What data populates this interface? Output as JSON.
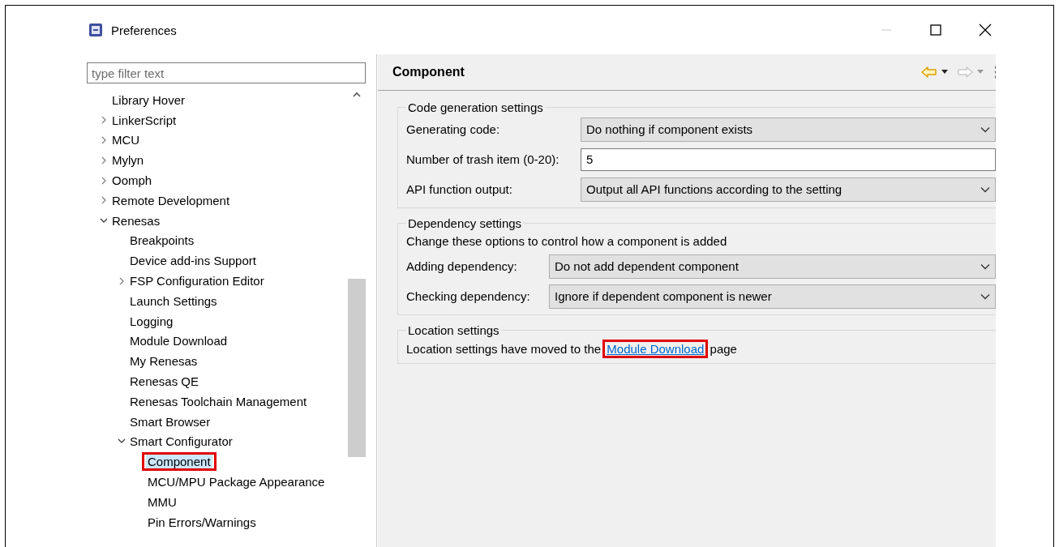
{
  "window": {
    "title": "Preferences",
    "minimize_disabled": true
  },
  "filter": {
    "placeholder": "type filter text"
  },
  "tree": [
    {
      "label": "Library Hover",
      "selected": false
    },
    {
      "label": "LinkerScript",
      "expanded": false,
      "selected": false
    },
    {
      "label": "MCU",
      "expanded": false,
      "selected": false
    },
    {
      "label": "Mylyn",
      "expanded": false,
      "selected": false
    },
    {
      "label": "Oomph",
      "expanded": false,
      "selected": false
    },
    {
      "label": "Remote Development",
      "expanded": false,
      "selected": false
    },
    {
      "label": "Renesas",
      "expanded": true,
      "selected": false,
      "children": [
        {
          "label": "Breakpoints",
          "selected": false
        },
        {
          "label": "Device add-ins Support",
          "selected": false
        },
        {
          "label": "FSP Configuration Editor",
          "expanded": false,
          "selected": false
        },
        {
          "label": "Launch Settings",
          "selected": false
        },
        {
          "label": "Logging",
          "selected": false
        },
        {
          "label": "Module Download",
          "selected": false
        },
        {
          "label": "My Renesas",
          "selected": false
        },
        {
          "label": "Renesas QE",
          "selected": false
        },
        {
          "label": "Renesas Toolchain Management",
          "selected": false
        },
        {
          "label": "Smart Browser",
          "selected": false
        },
        {
          "label": "Smart Configurator",
          "expanded": true,
          "selected": false,
          "children": [
            {
              "label": "Component",
              "selected": true,
              "highlighted": true
            },
            {
              "label": "MCU/MPU Package Appearance",
              "selected": false
            },
            {
              "label": "MMU",
              "selected": false
            },
            {
              "label": "Pin Errors/Warnings",
              "selected": false
            }
          ]
        }
      ]
    }
  ],
  "page": {
    "title": "Component",
    "back_disabled": false,
    "forward_disabled": true,
    "groups": [
      {
        "title": "Code generation settings",
        "rows": [
          {
            "kind": "dropdown",
            "label": "Generating code:",
            "value": "Do nothing if component exists"
          },
          {
            "kind": "text",
            "label": "Number of trash item (0-20):",
            "value": "5"
          },
          {
            "kind": "dropdown",
            "label": "API function output:",
            "value": "Output all API functions according to the setting"
          }
        ]
      },
      {
        "title": "Dependency settings",
        "description": "Change these options to control how a component is added",
        "rows": [
          {
            "kind": "dropdown",
            "label": "Adding dependency:",
            "value": "Do not add dependent component"
          },
          {
            "kind": "dropdown",
            "label": "Checking dependency:",
            "value": "Ignore if dependent component is newer"
          }
        ]
      },
      {
        "title": "Location settings",
        "message": {
          "before": "Location settings have moved to the",
          "link": "Module Download",
          "link_highlighted": true,
          "after": "page"
        }
      }
    ]
  }
}
